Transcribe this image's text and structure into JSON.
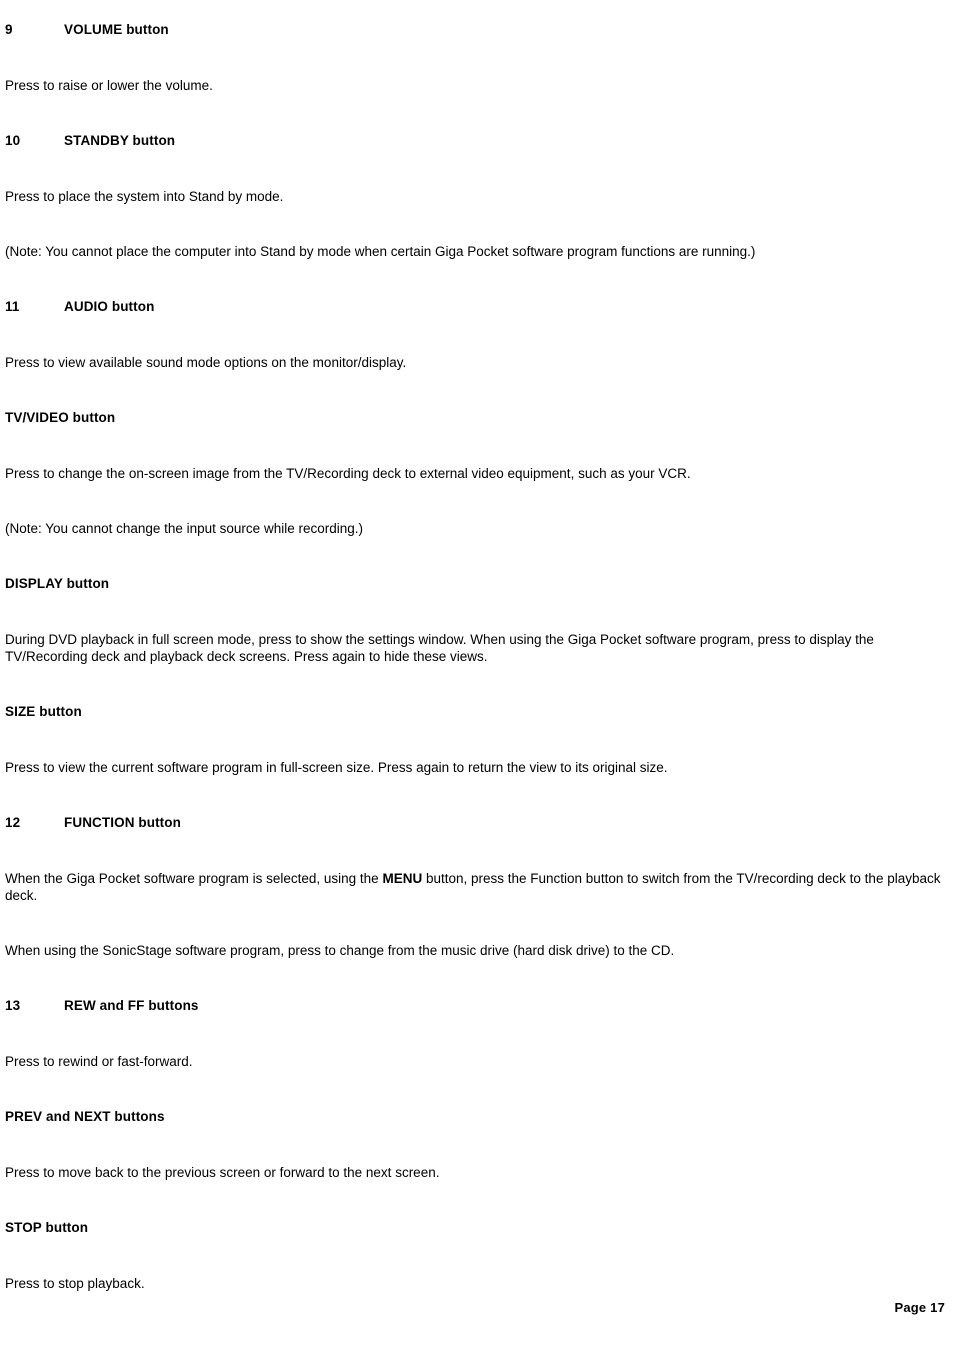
{
  "document": {
    "page_label": "Page 17"
  },
  "sections": [
    {
      "number": "9",
      "heading": "VOLUME button",
      "paragraphs": [
        {
          "text": "Press to raise or lower the volume."
        }
      ]
    },
    {
      "number": "10",
      "heading": "STANDBY button",
      "paragraphs": [
        {
          "text": "Press to place the system into Stand by mode."
        },
        {
          "text": "(Note: You cannot place the computer into Stand by mode when certain Giga Pocket software program functions are running.)"
        }
      ]
    },
    {
      "number": "11",
      "heading": "AUDIO button",
      "paragraphs": [
        {
          "text": "Press to view available sound mode options on the monitor/display."
        }
      ]
    },
    {
      "number": "",
      "heading": "TV/VIDEO button",
      "paragraphs": [
        {
          "text": "Press to change the on-screen image from the TV/Recording deck to external video equipment, such as your VCR."
        },
        {
          "text": "(Note: You cannot change the input source while recording.)"
        }
      ]
    },
    {
      "number": "",
      "heading": "DISPLAY button",
      "paragraphs": [
        {
          "text": "During DVD playback in full screen mode, press to show the settings window. When using the Giga Pocket software program, press to display the TV/Recording deck and playback deck screens. Press again to hide these views."
        }
      ]
    },
    {
      "number": "",
      "heading": "SIZE button",
      "paragraphs": [
        {
          "text": "Press to view the current software program in full-screen size. Press again to return the view to its original size."
        }
      ]
    },
    {
      "number": "12",
      "heading": "FUNCTION button",
      "paragraphs": [
        {
          "rich": true,
          "before": "When the Giga Pocket software program is selected, using the ",
          "bold": "MENU",
          "after": " button, press the Function button to switch from the TV/recording deck to the playback deck."
        },
        {
          "text": "When using the SonicStage software program, press to change from the music drive (hard disk drive) to the CD."
        }
      ]
    },
    {
      "number": "13",
      "heading": "REW and FF buttons",
      "paragraphs": [
        {
          "text": "Press to rewind or fast-forward."
        }
      ]
    },
    {
      "number": "",
      "heading": "PREV and NEXT buttons",
      "paragraphs": [
        {
          "text": "Press to move back to the previous screen or forward to the next screen."
        }
      ]
    },
    {
      "number": "",
      "heading": "STOP button",
      "paragraphs": [
        {
          "text": "Press to stop playback."
        }
      ]
    }
  ]
}
